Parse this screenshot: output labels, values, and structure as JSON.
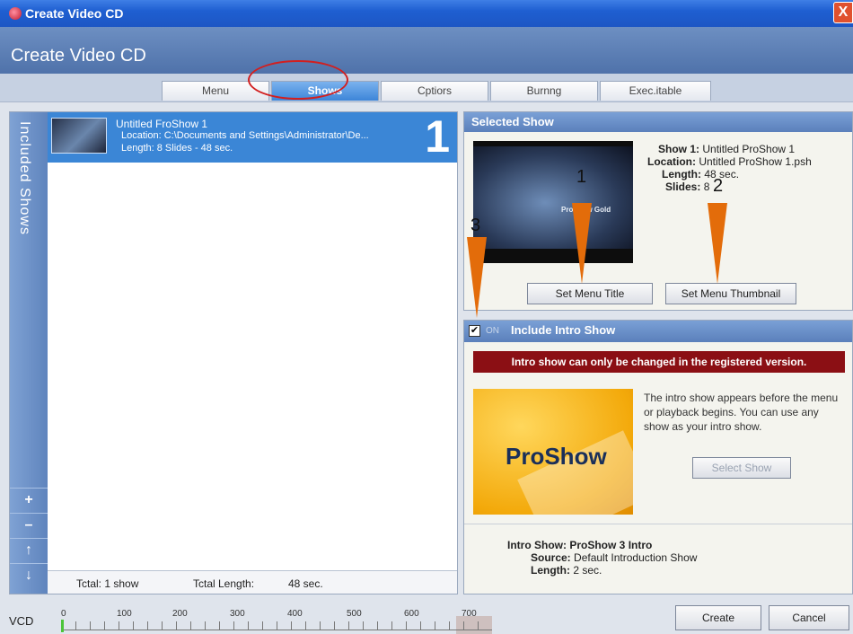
{
  "window": {
    "title": "Create Video CD",
    "heading": "Create Video CD",
    "close_glyph": "X"
  },
  "tabs": [
    {
      "label": "Menu"
    },
    {
      "label": "Shows"
    },
    {
      "label": "Cptiors"
    },
    {
      "label": "Burnng"
    },
    {
      "label": "Exec.itable"
    }
  ],
  "sidebar": {
    "label": "Included Shows",
    "buttons": [
      {
        "glyph": "+",
        "icon": "add-icon"
      },
      {
        "glyph": "–",
        "icon": "remove-icon"
      },
      {
        "glyph": "↑",
        "icon": "move-up-icon"
      },
      {
        "glyph": "↓",
        "icon": "move-down-icon"
      }
    ]
  },
  "show_list": [
    {
      "title": "Untitled FroShow 1",
      "location": "Location: C:\\Documents and Settings\\Administrator\\De...",
      "length": "Length: 8 Slides - 48 sec.",
      "number": "1"
    }
  ],
  "list_footer": {
    "total": "Tctal:  1 show",
    "total_length_label": "Tctal Length:",
    "total_length_value": "48 sec."
  },
  "selected_show": {
    "title": "Selected Show",
    "preview_watermark": "ProShow Gold",
    "show_label": "Show 1:",
    "show_value": "Untitled ProShow 1",
    "location_label": "Location:",
    "location_value": "Untitled ProShow 1.psh",
    "length_label": "Length:",
    "length_value": "48 sec.",
    "slides_label": "Slides:",
    "slides_value": "8",
    "set_menu_title": "Set Menu Title",
    "set_menu_thumbnail": "Set Menu Thumbnail"
  },
  "intro": {
    "checked": true,
    "on_label": "ON",
    "title": "Include Intro Show",
    "warning": "Intro show can only be changed in the registered version.",
    "logo_text": "ProShow",
    "description": "The intro show appears before the menu or playback begins. You can use any show as your intro show.",
    "select_show": "Select Show",
    "intro_show_label": "Intro Show:",
    "intro_show_value": "ProShow 3 Intro",
    "source_label": "Source:",
    "source_value": "Default Introduction Show",
    "length_label": "Length:",
    "length_value": "2 sec."
  },
  "timeline": {
    "format": "VCD",
    "tick_labels": [
      "0",
      "100",
      "200",
      "300",
      "400",
      "500",
      "600",
      "700"
    ],
    "fill_fraction": 0.007
  },
  "actions": {
    "create": "Create",
    "cancel": "Cancel"
  },
  "annotations": {
    "callouts": [
      "1",
      "2",
      "3"
    ],
    "ring_color": "#d21f1f",
    "callout_color": "#e36c0a"
  }
}
